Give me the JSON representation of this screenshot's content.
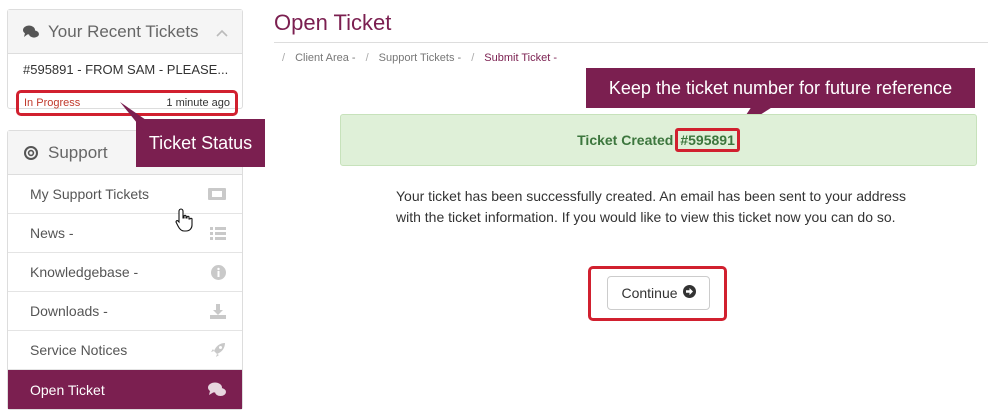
{
  "sidebar": {
    "recent": {
      "title": "Your Recent Tickets",
      "ticket_title": "#595891 - FROM SAM - PLEASE...",
      "status": "In Progress",
      "time": "1 minute ago"
    },
    "support": {
      "title": "Support",
      "items": [
        {
          "label": "My Support Tickets",
          "icon": "ticket-icon"
        },
        {
          "label": "News -",
          "icon": "list-icon"
        },
        {
          "label": "Knowledgebase -",
          "icon": "info-circle-icon"
        },
        {
          "label": "Downloads -",
          "icon": "download-icon"
        },
        {
          "label": "Service Notices",
          "icon": "rocket-icon"
        },
        {
          "label": "Open Ticket",
          "icon": "comments-icon",
          "active": true
        }
      ]
    }
  },
  "callouts": {
    "status": "Ticket Status",
    "keep": "Keep the ticket number for future reference"
  },
  "main": {
    "title": "Open Ticket",
    "breadcrumb": [
      "Client Area -",
      "Support Tickets -",
      "Submit Ticket -"
    ],
    "alert_label": "Ticket Created",
    "ticket_number": "#595891",
    "message": "Your ticket has been successfully created. An email has been sent to your address with the ticket information. If you would like to view this ticket now you can do so.",
    "continue_label": "Continue"
  },
  "colors": {
    "brand": "#7b1f50",
    "highlight": "#d1202f",
    "success_bg": "#dff0d8",
    "success_text": "#3c763d"
  }
}
